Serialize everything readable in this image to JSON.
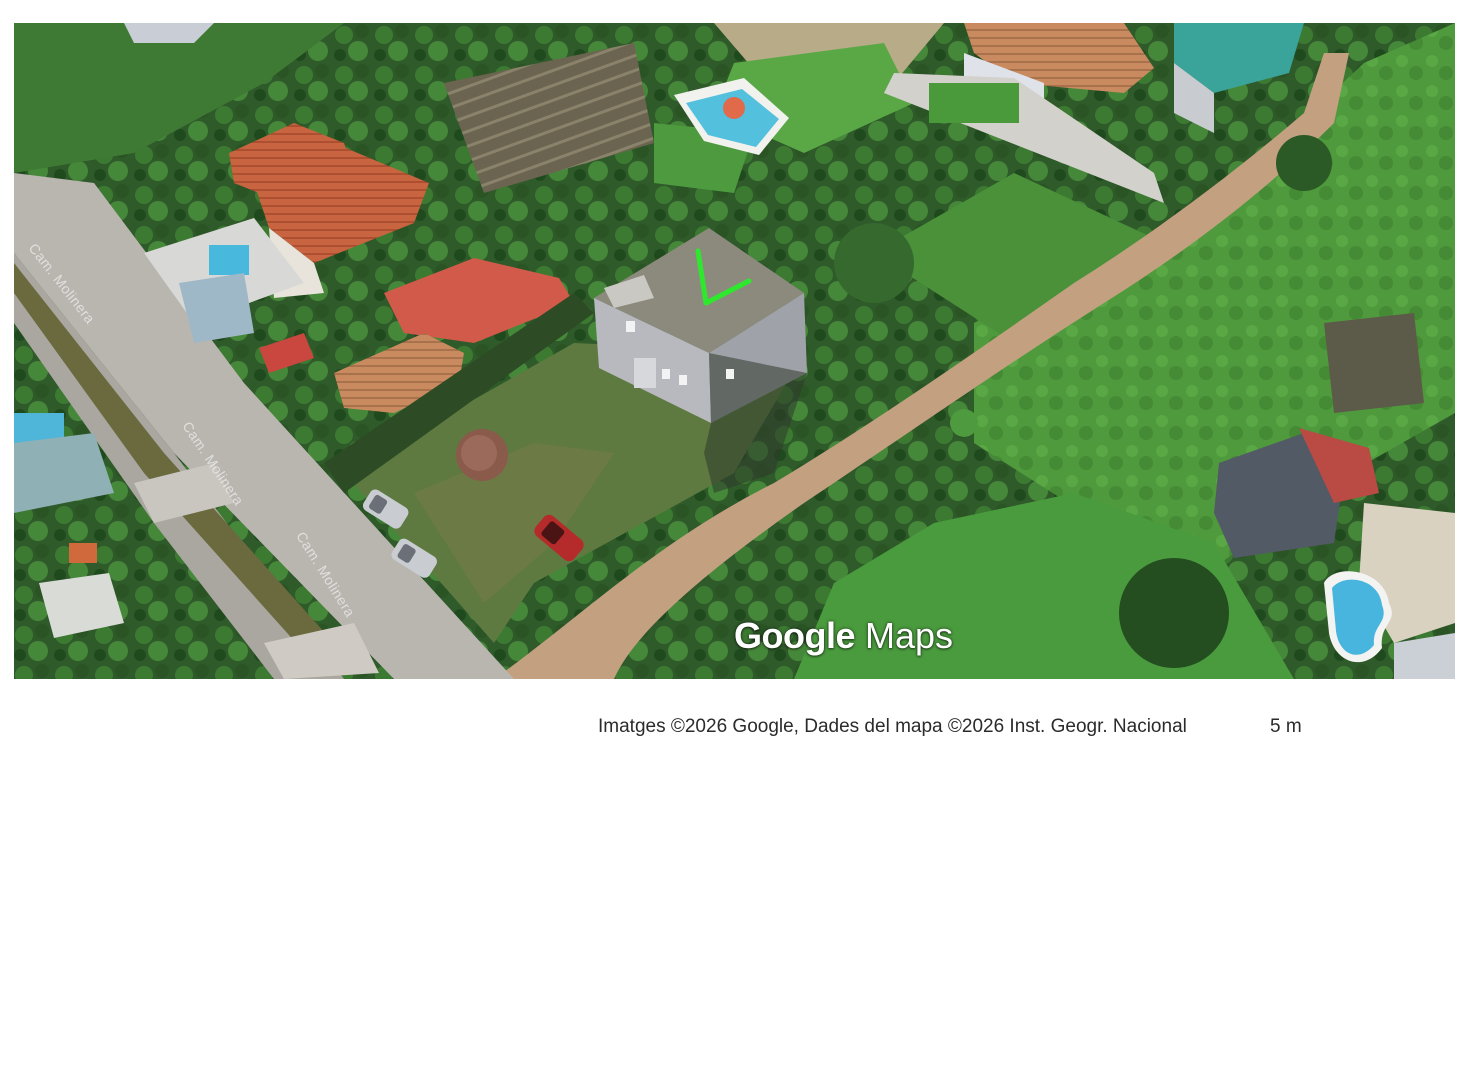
{
  "map": {
    "road_labels": [
      "Cam. Molinera",
      "Cam. Molinera",
      "Cam. Molinera"
    ],
    "logo": {
      "brand": "Google",
      "product": "Maps"
    },
    "attribution": "Imatges ©2026 Google, Dades del mapa ©2026 Inst. Geogr. Nacional",
    "scale": "5 m",
    "marker_icon": "green-check-marker",
    "marker_color": "#2ee82e"
  }
}
